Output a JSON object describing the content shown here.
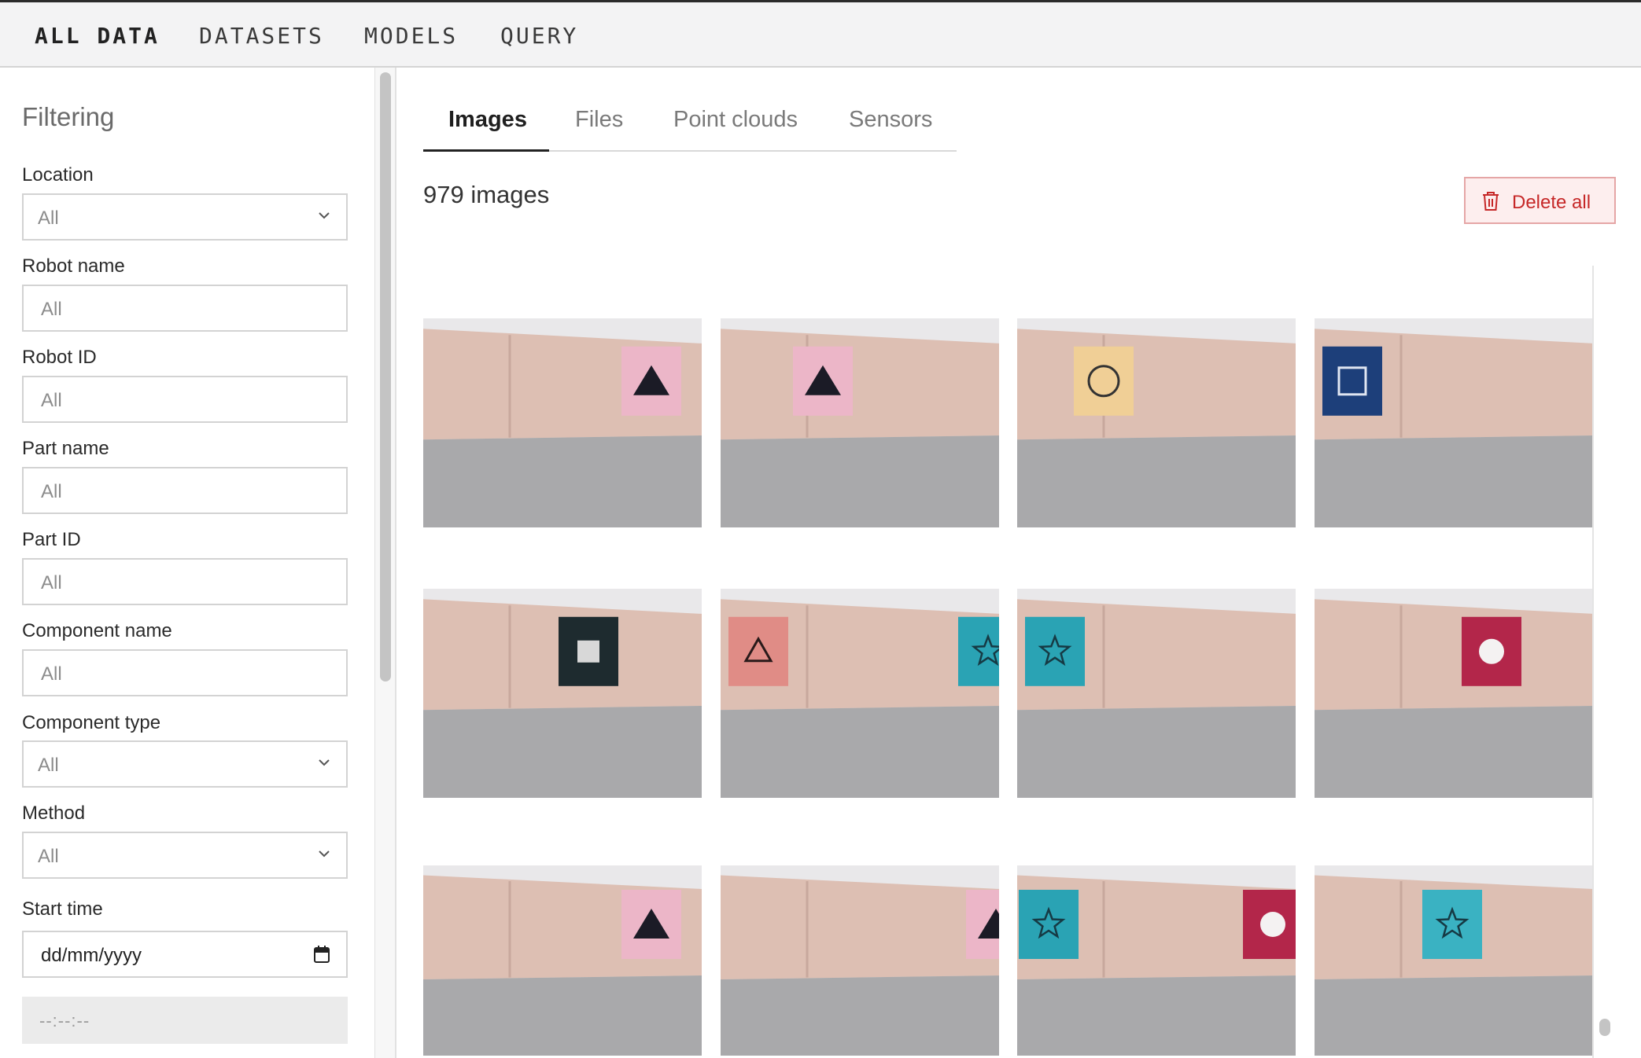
{
  "nav": {
    "items": [
      {
        "label": "ALL DATA",
        "active": true
      },
      {
        "label": "DATASETS",
        "active": false
      },
      {
        "label": "MODELS",
        "active": false
      },
      {
        "label": "QUERY",
        "active": false
      }
    ]
  },
  "sidebar": {
    "title": "Filtering",
    "fields": [
      {
        "label": "Location",
        "value": "All",
        "type": "select"
      },
      {
        "label": "Robot name",
        "value": "All",
        "type": "input"
      },
      {
        "label": "Robot ID",
        "value": "All",
        "type": "input"
      },
      {
        "label": "Part name",
        "value": "All",
        "type": "input"
      },
      {
        "label": "Part ID",
        "value": "All",
        "type": "input"
      },
      {
        "label": "Component name",
        "value": "All",
        "type": "input"
      },
      {
        "label": "Component type",
        "value": "All",
        "type": "select"
      },
      {
        "label": "Method",
        "value": "All",
        "type": "select"
      }
    ],
    "start_time": {
      "label": "Start time",
      "date_placeholder": "dd/mm/yyyy",
      "time_placeholder": "--:--:--"
    }
  },
  "tabs": [
    {
      "label": "Images",
      "active": true
    },
    {
      "label": "Files",
      "active": false
    },
    {
      "label": "Point clouds",
      "active": false
    },
    {
      "label": "Sensors",
      "active": false
    }
  ],
  "main": {
    "count_text": "979 images",
    "delete_label": "Delete all"
  },
  "images": [
    {
      "name": "image-1",
      "shapes": [
        {
          "kind": "triangle",
          "card": "#ecb6c8"
        }
      ]
    },
    {
      "name": "image-2",
      "shapes": [
        {
          "kind": "triangle",
          "card": "#ecb6c8"
        }
      ]
    },
    {
      "name": "image-3",
      "shapes": [
        {
          "kind": "circle-outline",
          "card": "#f0cf96"
        }
      ]
    },
    {
      "name": "image-4",
      "shapes": [
        {
          "kind": "square-outline",
          "card": "#1d3f7a"
        }
      ]
    },
    {
      "name": "image-5",
      "shapes": [
        {
          "kind": "square-filled",
          "card": "#1e2b2f"
        }
      ]
    },
    {
      "name": "image-6",
      "shapes": [
        {
          "kind": "triangle-outline",
          "card": "#e08c86"
        },
        {
          "kind": "star",
          "card": "#2aa3b4"
        }
      ]
    },
    {
      "name": "image-7",
      "shapes": [
        {
          "kind": "star",
          "card": "#2aa3b4"
        }
      ]
    },
    {
      "name": "image-8",
      "shapes": [
        {
          "kind": "circle-filled",
          "card": "#b3264a"
        }
      ]
    },
    {
      "name": "image-9",
      "shapes": [
        {
          "kind": "triangle",
          "card": "#ecb6c8"
        }
      ]
    },
    {
      "name": "image-10",
      "shapes": [
        {
          "kind": "triangle",
          "card": "#ecb6c8"
        }
      ]
    },
    {
      "name": "image-11",
      "shapes": [
        {
          "kind": "star",
          "card": "#2aa3b4"
        },
        {
          "kind": "circle-filled",
          "card": "#b3264a"
        }
      ]
    },
    {
      "name": "image-12",
      "shapes": [
        {
          "kind": "star",
          "card": "#3ab2c2"
        }
      ]
    }
  ]
}
